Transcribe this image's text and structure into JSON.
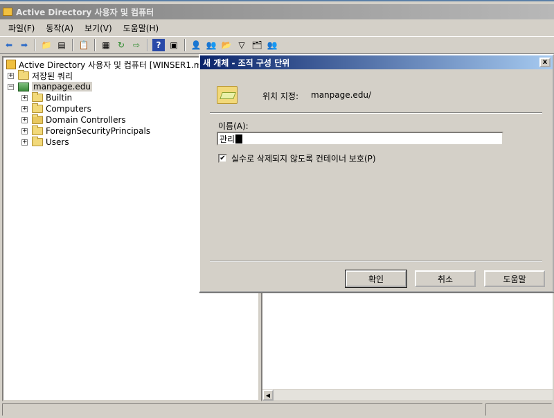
{
  "main_window": {
    "title": "Active Directory 사용자 및 컴퓨터"
  },
  "menu": {
    "items": [
      {
        "label": "파일(F)"
      },
      {
        "label": "동작(A)"
      },
      {
        "label": "보기(V)"
      },
      {
        "label": "도움말(H)"
      }
    ]
  },
  "toolbar": {
    "icons": [
      "back-icon",
      "forward-icon",
      "up-folder-icon",
      "show-tree-icon",
      "clipboard-icon",
      "properties-icon",
      "refresh-icon",
      "export-icon",
      "help-icon",
      "console-icon",
      "new-user-icon",
      "new-group-icon",
      "new-ou-icon",
      "filter-icon",
      "add-to-group-icon",
      "delegate-icon"
    ]
  },
  "tree": {
    "root_label": "Active Directory 사용자 및 컴퓨터 [WINSER1.m",
    "saved_queries_label": "저장된 쿼리",
    "domain_label": "manpage.edu",
    "children": [
      {
        "label": "Builtin",
        "icon": "folder-icon"
      },
      {
        "label": "Computers",
        "icon": "folder-icon"
      },
      {
        "label": "Domain Controllers",
        "icon": "ou-icon"
      },
      {
        "label": "ForeignSecurityPrincipals",
        "icon": "folder-icon"
      },
      {
        "label": "Users",
        "icon": "folder-icon"
      }
    ]
  },
  "dialog": {
    "title": "새 개체 - 조직 구성 단위",
    "close_label": "x",
    "location_label": "위치 지정:",
    "location_value": "manpage.edu/",
    "name_label": "이름(A):",
    "name_value": "관리",
    "protect_label": "실수로 삭제되지 않도록 컨테이너 보호(P)",
    "protect_checked": true,
    "ok_label": "확인",
    "cancel_label": "취소",
    "help_label": "도움말"
  }
}
